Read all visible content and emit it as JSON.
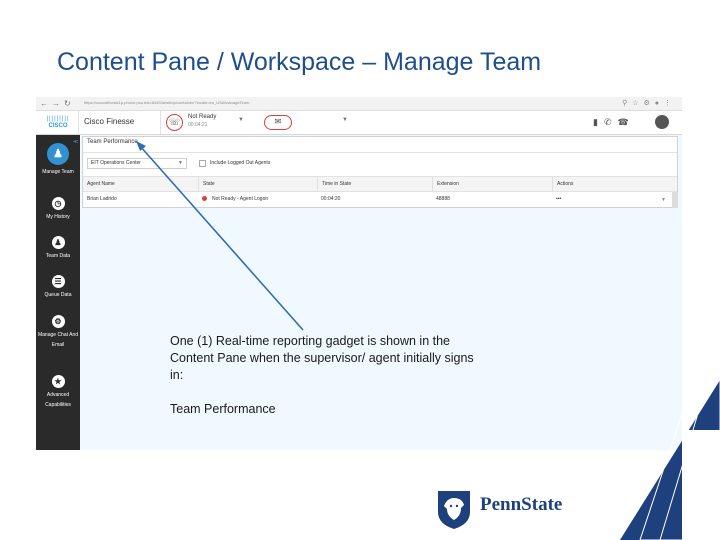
{
  "slide": {
    "title": "Content Pane / Workspace – Manage Team"
  },
  "browser": {
    "url": "https://cuccwfinesle1p.phone.psu.edu:8445/desktop/container/?locale=en_US#/manageTeam"
  },
  "finesse": {
    "logo_text": "CISCO",
    "app_title": "Cisco Finesse",
    "agent_state": "Not Ready",
    "state_timer": "00:04:21",
    "left_nav": [
      {
        "label": "Manage Team",
        "icon": "manage-team-icon",
        "active": true
      },
      {
        "label": "My History",
        "icon": "history-clock-icon",
        "active": false
      },
      {
        "label": "Team Data",
        "icon": "team-data-icon",
        "active": false
      },
      {
        "label": "Queue Data",
        "icon": "queue-data-icon",
        "active": false
      },
      {
        "label": "Manage Chat And Email",
        "icon": "gear-icon",
        "active": false
      },
      {
        "label": "Advanced Capabilities",
        "icon": "advanced-capabilities-icon",
        "active": false
      }
    ],
    "gadget": {
      "title": "Team Performance",
      "team_select": "EIT Operations Center",
      "include_logged_out_label": "Include Logged Out Agents",
      "columns": [
        "Agent Name",
        "State",
        "Time in State",
        "Extension",
        "Actions"
      ],
      "rows": [
        {
          "agent_name": "Brian Ladrido",
          "state": "Not Ready - Agent Logon",
          "time_in_state": "00:04:20",
          "extension": "48888",
          "actions": "•••"
        }
      ]
    }
  },
  "callout": {
    "line1": "One (1) Real-time reporting gadget is shown in the",
    "line2": "Content Pane when the supervisor/ agent initially signs",
    "line3": "in:",
    "line4": "Team Performance"
  },
  "branding": {
    "wordmark": "PennState",
    "color": "#1e407c"
  }
}
